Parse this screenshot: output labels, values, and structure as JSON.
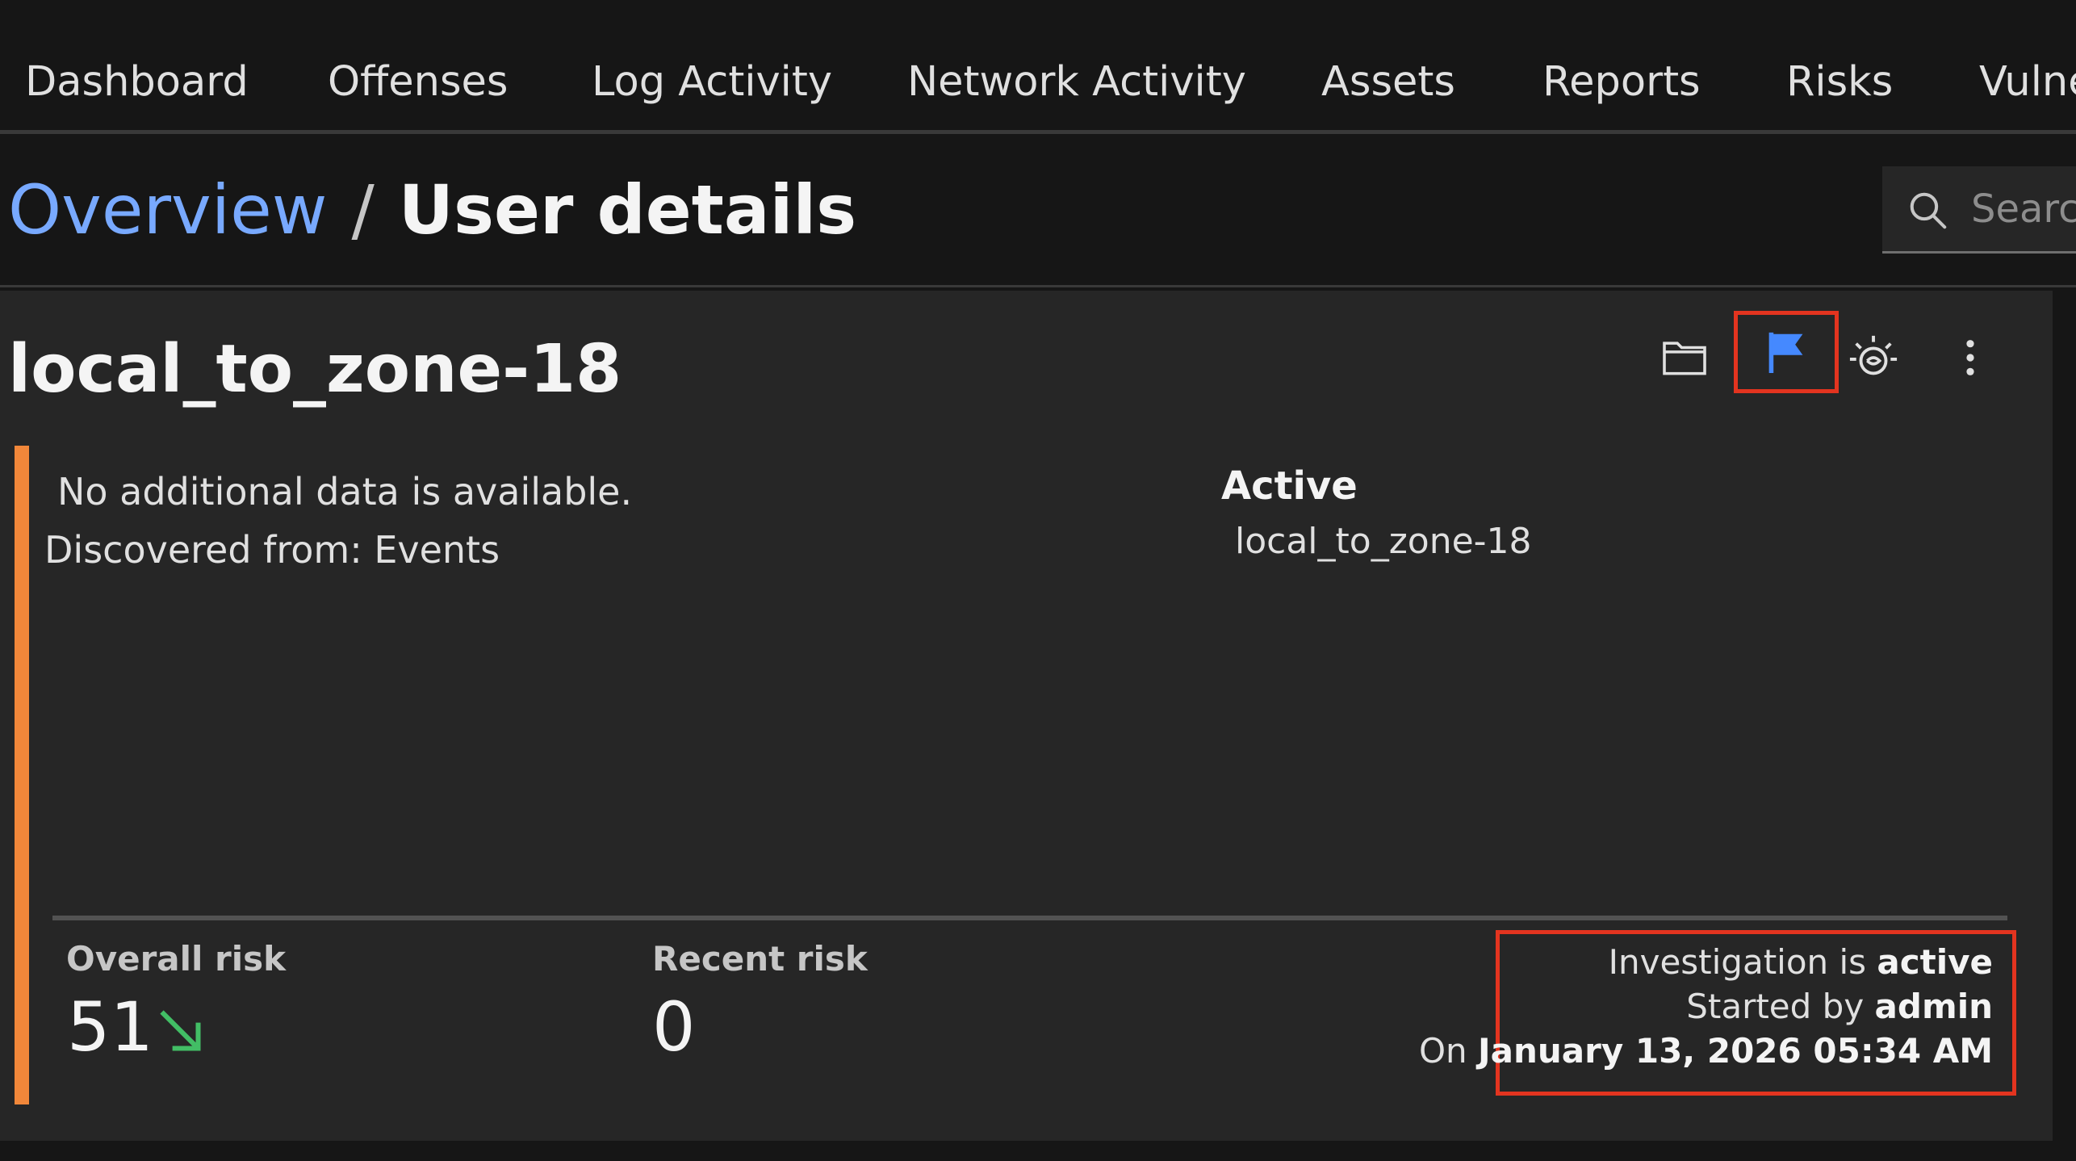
{
  "nav": {
    "items": [
      {
        "label": "Dashboard"
      },
      {
        "label": "Offenses"
      },
      {
        "label": "Log Activity"
      },
      {
        "label": "Network Activity"
      },
      {
        "label": "Assets"
      },
      {
        "label": "Reports"
      },
      {
        "label": "Risks"
      },
      {
        "label": "Vulne"
      }
    ]
  },
  "breadcrumb": {
    "parent": "Overview",
    "separator": "/",
    "current": "User details"
  },
  "search": {
    "placeholder": "Search",
    "icon": "search-icon"
  },
  "card": {
    "title": "local_to_zone-18",
    "toolbar": {
      "folder_icon": "folder-icon",
      "flag_icon": "flag-icon",
      "watson_icon": "watson-icon",
      "overflow_icon": "overflow-menu-icon"
    },
    "info": {
      "line1": "No additional data is available.",
      "line2": "Discovered from: Events"
    },
    "status": {
      "heading": "Active",
      "value": "local_to_zone-18"
    },
    "metrics": {
      "overall_label": "Overall risk",
      "overall_value": "51",
      "overall_trend": "trend-down-icon",
      "recent_label": "Recent risk",
      "recent_value": "0"
    },
    "investigation": {
      "status_prefix": "Investigation is",
      "status_value": "active",
      "started_prefix": "Started by",
      "started_by": "admin",
      "on_prefix": "On",
      "date": "January 13, 2026 05:34 AM"
    }
  },
  "colors": {
    "accent_orange": "#f1873a",
    "highlight_red": "#e3341f",
    "link_blue": "#78a9ff",
    "flag_blue": "#4589ff",
    "trend_green": "#42be65"
  }
}
